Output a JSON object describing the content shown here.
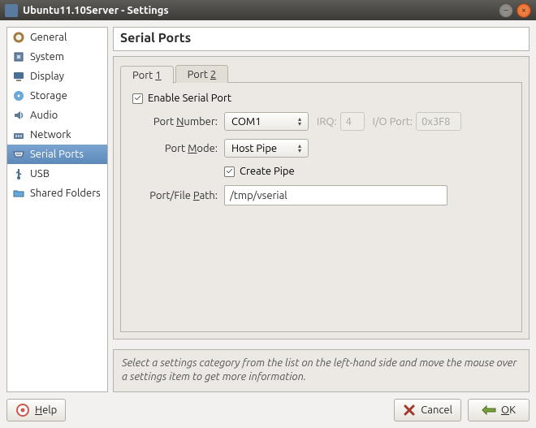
{
  "window": {
    "title": "Ubuntu11.10Server - Settings"
  },
  "sidebar": {
    "items": [
      {
        "label": "General"
      },
      {
        "label": "System"
      },
      {
        "label": "Display"
      },
      {
        "label": "Storage"
      },
      {
        "label": "Audio"
      },
      {
        "label": "Network"
      },
      {
        "label": "Serial Ports"
      },
      {
        "label": "USB"
      },
      {
        "label": "Shared Folders"
      }
    ],
    "selected_index": 6
  },
  "page": {
    "title": "Serial Ports",
    "tabs": [
      {
        "prefix": "Port ",
        "key": "1"
      },
      {
        "prefix": "Port ",
        "key": "2"
      }
    ],
    "active_tab": 0,
    "form": {
      "enable_label_prefix": "E",
      "enable_label_rest": "nable Serial Port",
      "enable_checked": true,
      "port_number": {
        "label_pre": "Port ",
        "label_key": "N",
        "label_post": "umber:",
        "value": "COM1"
      },
      "irq": {
        "label_key": "I",
        "label_rest": "RQ:",
        "value": "4"
      },
      "io_port": {
        "label": "I/O Port:",
        "value": "0x3F8"
      },
      "port_mode": {
        "label_pre": "Port ",
        "label_key": "M",
        "label_post": "ode:",
        "value": "Host Pipe"
      },
      "create_pipe": {
        "label_key": "C",
        "label_rest": "reate Pipe",
        "checked": true
      },
      "port_path": {
        "label_pre": "Port/File ",
        "label_key": "P",
        "label_post": "ath:",
        "value": "/tmp/vserial"
      }
    }
  },
  "hint": "Select a settings category from the list on the left-hand side and move the mouse over a settings item to get more information.",
  "buttons": {
    "help_key": "H",
    "help_rest": "elp",
    "cancel": "Cancel",
    "ok_key": "O",
    "ok_rest": "K"
  }
}
